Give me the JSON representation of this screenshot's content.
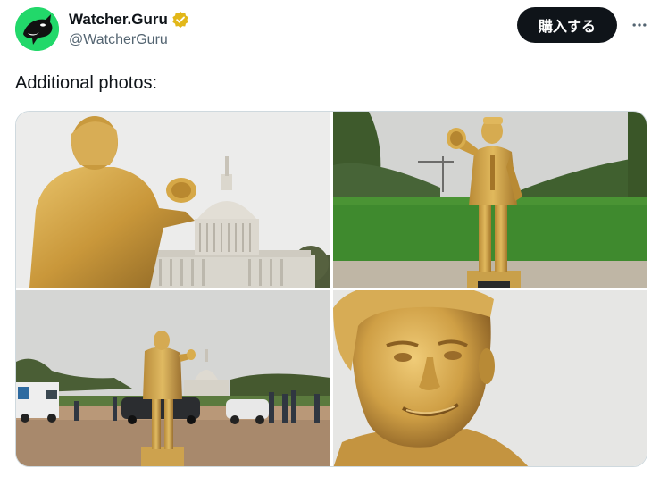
{
  "account": {
    "display_name": "Watcher.Guru",
    "handle": "@WatcherGuru",
    "verified_icon": "gold-verified-badge-icon",
    "avatar_icon": "orca-logo-icon"
  },
  "actions": {
    "buy_label": "購入する",
    "more_icon": "more-dots-icon"
  },
  "tweet": {
    "text": "Additional photos:"
  },
  "media": [
    {
      "name": "photo-statue-back-capitol"
    },
    {
      "name": "photo-statue-front-mall"
    },
    {
      "name": "photo-statue-wide-crowd"
    },
    {
      "name": "photo-statue-face-closeup"
    }
  ],
  "colors": {
    "accent": "#0f1419",
    "avatar_bg": "#22d86a",
    "gold": "#d4a94a",
    "verified_gold": "#e2b719"
  }
}
